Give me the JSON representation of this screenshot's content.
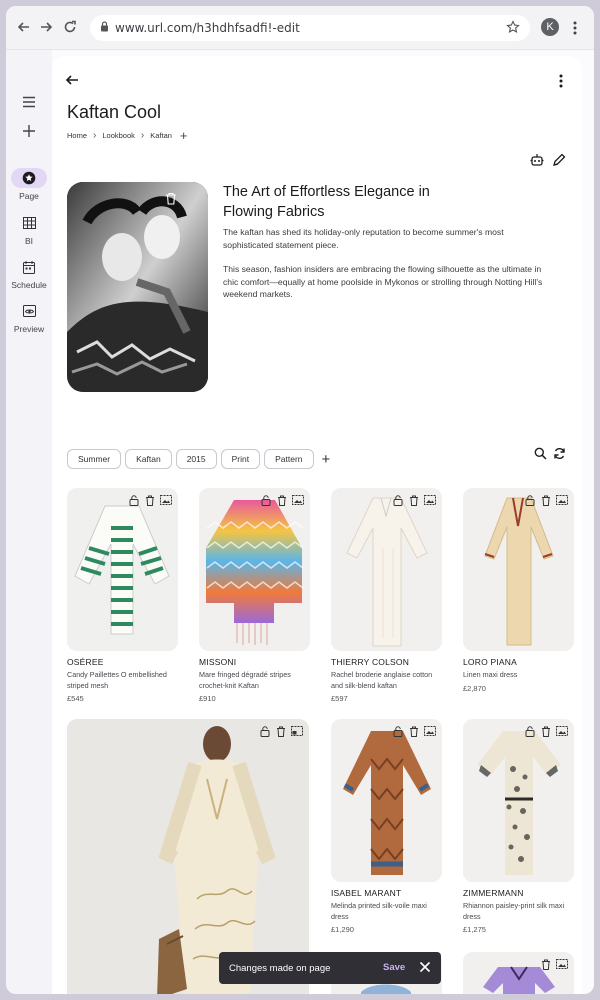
{
  "browser": {
    "url": "www.url.com/h3hdhfsadfi!-edit",
    "avatar_letter": "K"
  },
  "rail": {
    "items": [
      {
        "label": "Page",
        "icon": "star-icon",
        "active": true
      },
      {
        "label": "BI",
        "icon": "grid-icon",
        "active": false
      },
      {
        "label": "Schedule",
        "icon": "calendar-icon",
        "active": false
      },
      {
        "label": "Preview",
        "icon": "preview-icon",
        "active": false
      }
    ]
  },
  "page": {
    "title": "Kaftan Cool",
    "breadcrumb": [
      "Home",
      "Lookbook",
      "Kaftan"
    ]
  },
  "article": {
    "title": "The Art of Effortless Elegance in Flowing Fabrics",
    "para1": "The kaftan has shed its holiday-only reputation to become summer's most sophisticated statement piece.",
    "para2": "This season, fashion insiders are embracing the flowing silhouette as the ultimate in chic comfort—equally at home poolside in Mykonos or strolling through Notting Hill's weekend markets."
  },
  "tags": [
    "Summer",
    "Kaftan",
    "2015",
    "Print",
    "Pattern"
  ],
  "products": [
    {
      "brand": "OSÉREE",
      "desc": "Candy Paillettes O embellished striped mesh",
      "price": "£545"
    },
    {
      "brand": "MISSONI",
      "desc": "Mare fringed dégradé stripes crochet-knit Kaftan",
      "price": "£910"
    },
    {
      "brand": "THIERRY COLSON",
      "desc": "Rachel broderie anglaise cotton and silk-blend kaftan",
      "price": "£597"
    },
    {
      "brand": "LORO PIANA",
      "desc": "Linen maxi dress",
      "price": "£2,870"
    },
    {
      "brand": "ISABEL MARANT",
      "desc": "Melinda printed silk-voile maxi dress",
      "price": "£1,290"
    },
    {
      "brand": "ZIMMERMANN",
      "desc": "Rhiannon paisley-print silk maxi dress",
      "price": "£1,275"
    }
  ],
  "snackbar": {
    "message": "Changes made on page",
    "action": "Save"
  },
  "colors": {
    "accent": "#7c4dff",
    "rail_active": "#e3d8f4",
    "snackbar": "#2f2f35"
  }
}
